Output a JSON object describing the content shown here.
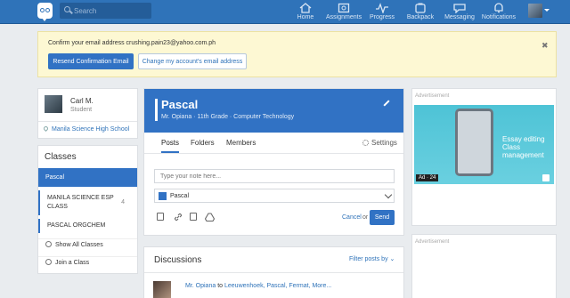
{
  "topbar": {
    "search_placeholder": "Search",
    "nav": [
      {
        "label": "Home"
      },
      {
        "label": "Assignments"
      },
      {
        "label": "Progress"
      },
      {
        "label": "Backpack"
      },
      {
        "label": "Messaging"
      },
      {
        "label": "Notifications"
      }
    ]
  },
  "notice": {
    "text": "Confirm your email address crushing.pain23@yahoo.com.ph",
    "resend": "Resend Confirmation Email",
    "change": "Change my account's email address",
    "close": "✖"
  },
  "profile": {
    "name": "Carl M.",
    "role": "Student",
    "school": "Manila Science High School"
  },
  "classes": {
    "title": "Classes",
    "items": [
      {
        "label": "Pascal"
      },
      {
        "label": "MANILA SCIENCE ESP",
        "label2": "CLASS",
        "count": "4"
      },
      {
        "label": "PASCAL ORGCHEM"
      }
    ],
    "show_all": "Show All Classes",
    "join": "Join a Class"
  },
  "group": {
    "title": "Pascal",
    "subtitle": "Mr. Opiana · 11th Grade · Computer Technology",
    "tabs": [
      "Posts",
      "Folders",
      "Members"
    ],
    "settings": "Settings"
  },
  "compose": {
    "placeholder": "Type your note here...",
    "selected": "Pascal",
    "cancel": "Cancel",
    "or": "or",
    "send": "Send"
  },
  "discussions": {
    "title": "Discussions",
    "filter": "Filter posts by",
    "line_author": "Mr. Opiana",
    "line_to": "to",
    "line_targets": "Leeuwenhoek, Pascal, Fermat, More..."
  },
  "ads": {
    "label": "Advertisement",
    "text1": "Essay editing",
    "text2": "Class management",
    "tag": "Ad · 24"
  }
}
